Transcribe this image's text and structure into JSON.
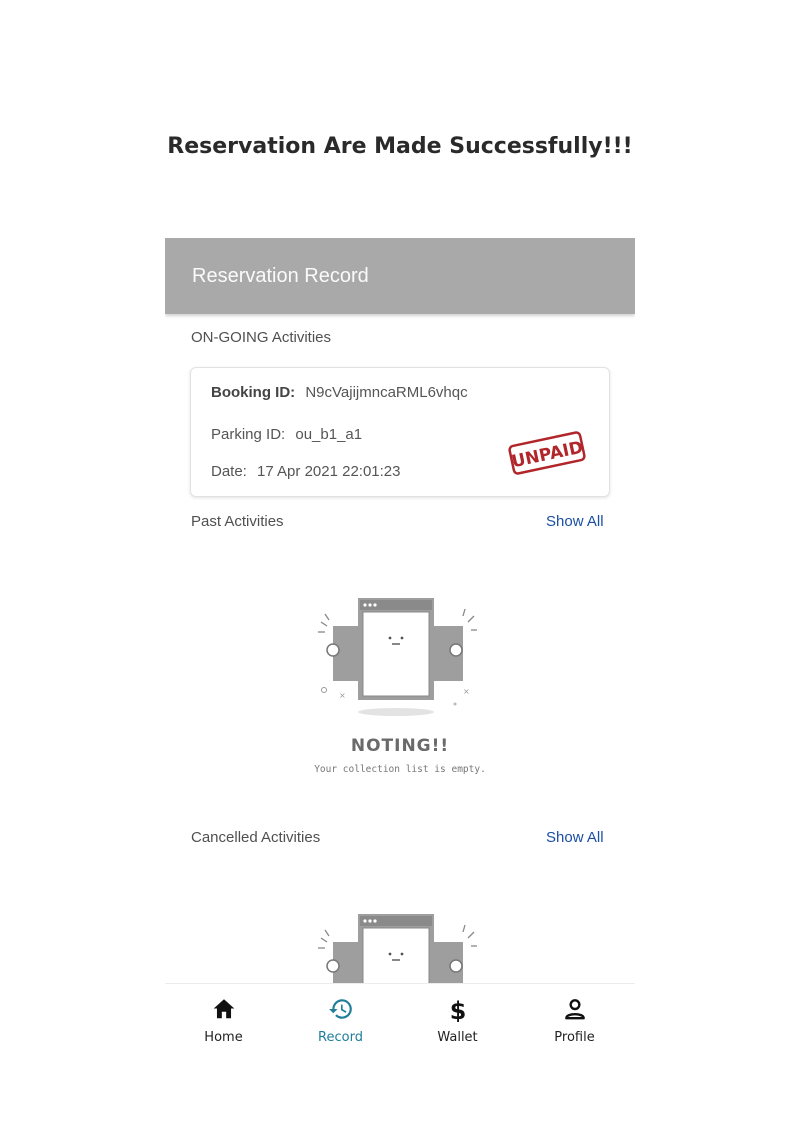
{
  "caption": "Reservation Are Made Successfully!!!",
  "appbar": {
    "title": "Reservation Record"
  },
  "ongoing": {
    "label": "ON-GOING Activities",
    "booking": {
      "booking_id_label": "Booking ID:",
      "booking_id": "N9cVajijmncaRML6vhqc",
      "parking_id_label": "Parking ID:",
      "parking_id": "ou_b1_a1",
      "date_label": "Date:",
      "date": "17 Apr 2021 22:01:23",
      "status_stamp": "UNPAID",
      "stamp_color": "#b0262b"
    }
  },
  "past": {
    "label": "Past Activities",
    "show_all": "Show All",
    "empty_title": "NOTING!!",
    "empty_subtitle": "Your collection list is empty."
  },
  "cancelled": {
    "label": "Cancelled Activities",
    "show_all": "Show All"
  },
  "bottom_nav": {
    "active": "Record",
    "accent_color": "#1f7e9a",
    "items": [
      {
        "label": "Home",
        "icon": "home-icon"
      },
      {
        "label": "Record",
        "icon": "history-icon"
      },
      {
        "label": "Wallet",
        "icon": "dollar-icon"
      },
      {
        "label": "Profile",
        "icon": "person-icon"
      }
    ]
  }
}
